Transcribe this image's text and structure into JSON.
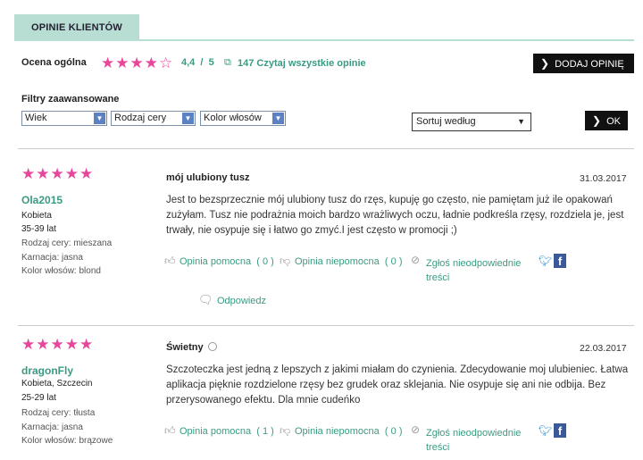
{
  "tab": {
    "label": "OPINIE KLIENTÓW"
  },
  "summary": {
    "label": "Ocena ogólna",
    "stars": "★★★★☆",
    "rating_value": 4.4,
    "rating": "4,4",
    "separator": "/",
    "max": "5",
    "count_link": "147 Czytaj wszystkie opinie",
    "add_button": "DODAJ OPINIĘ"
  },
  "filters": {
    "label": "Filtry zaawansowane",
    "selects": [
      "Wiek",
      "Rodzaj cery",
      "Kolor włosów"
    ],
    "sort": "Sortuj według",
    "ok": "OK"
  },
  "reviews": [
    {
      "stars": "★★★★★",
      "rating_value": 5,
      "user": "Ola2015",
      "gender_city": "Kobieta",
      "age": "35-39 lat",
      "skin": "Rodzaj cery: mieszana",
      "complexion": "Karnacja: jasna",
      "hair": "Kolor włosów: blond",
      "title": "mój ulubiony tusz",
      "date": "31.03.2017",
      "text": "Jest to bezsprzecznie mój ulubiony tusz do rzęs, kupuję go często, nie pamiętam już ile opakowań zużyłam. Tusz nie podrażnia moich bardzo wrażliwych oczu, ładnie podkreśla rzęsy, rozdziela je, jest trwały, nie osypuje się i łatwo go zmyć.I jest często w promocji ;)",
      "helpful": "Opinia pomocna",
      "helpful_count": "( 0 )",
      "unhelpful": "Opinia niepomocna",
      "unhelpful_count": "( 0 )",
      "report_line1": "Zgłoś nieodpowiednie",
      "report_line2": "treści",
      "reply": "Odpowiedz"
    },
    {
      "stars": "★★★★★",
      "rating_value": 5,
      "user": "dragonFly",
      "gender_city": "Kobieta, Szczecin",
      "age": "25-29 lat",
      "skin": "Rodzaj cery: tłusta",
      "complexion": "Karnacja: jasna",
      "hair": "Kolor włosów: brązowe",
      "title": "Świetny",
      "date": "22.03.2017",
      "text": "Szczoteczka jest jedną z lepszych z jakimi miałam do czynienia. Zdecydowanie moj ulubieniec. Łatwa aplikacja pięknie rozdzielone rzęsy bez grudek oraz sklejania. Nie osypuje się ani nie odbija. Bez przerysowanego efektu. Dla mnie cudeńko",
      "helpful": "Opinia pomocna",
      "helpful_count": "( 1 )",
      "unhelpful": "Opinia niepomocna",
      "unhelpful_count": "( 0 )",
      "report_line1": "Zgłoś nieodpowiednie",
      "report_line2": "treści"
    }
  ],
  "colors": {
    "accent_green": "#3a9b82",
    "star_pink": "#e8469b",
    "tab_bg": "#b8ddd2",
    "facebook": "#3b5998",
    "twitter": "#2e8bc8"
  },
  "icons": [
    "window-link-icon",
    "chevron-right-icon",
    "dropdown-arrow-icon",
    "thumbs-up-icon",
    "thumbs-down-icon",
    "report-icon",
    "twitter-icon",
    "facebook-icon",
    "speech-bubble-icon",
    "info-icon"
  ]
}
